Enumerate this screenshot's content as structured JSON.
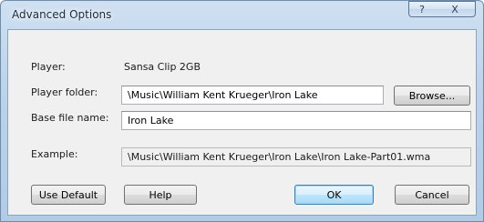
{
  "window": {
    "title": "Advanced Options",
    "help_button": "?",
    "close_button": "X"
  },
  "fields": {
    "player_label": "Player:",
    "player_value": "Sansa Clip 2GB",
    "player_folder_label": "Player folder:",
    "player_folder_value": "\\Music\\William Kent Krueger\\Iron Lake",
    "base_file_name_label": "Base file name:",
    "base_file_name_value": "Iron Lake",
    "example_label": "Example:",
    "example_value": "\\Music\\William Kent Krueger\\Iron Lake\\Iron Lake-Part01.wma"
  },
  "buttons": {
    "browse": "Browse...",
    "use_default": "Use Default",
    "help": "Help",
    "ok": "OK",
    "cancel": "Cancel"
  }
}
